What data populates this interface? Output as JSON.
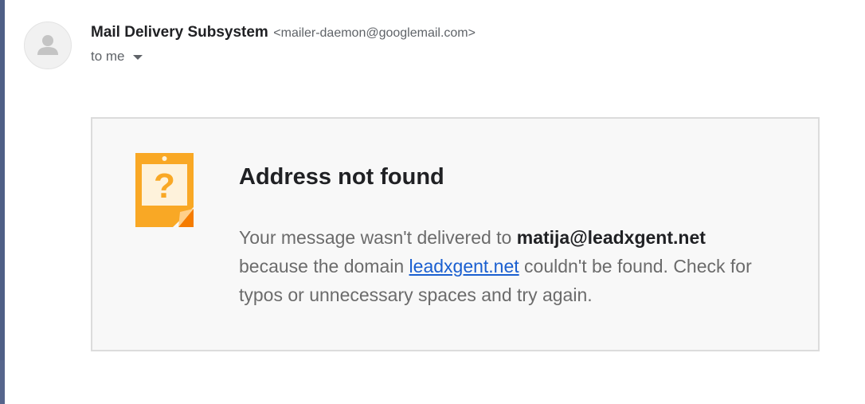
{
  "header": {
    "sender_name": "Mail Delivery Subsystem",
    "sender_email": "<mailer-daemon@googlemail.com>",
    "recipient": "to me"
  },
  "card": {
    "title": "Address not found",
    "line1_prefix": "Your message wasn't delivered to ",
    "recipient_address": "matija@leadxgent.net",
    "line2_prefix": "because the domain ",
    "domain_link": "leadxgent.net",
    "line2_suffix": " couldn't be found. Check for",
    "line3": "typos or unnecessary spaces and try again."
  },
  "icons": {
    "avatar": "person-icon",
    "dropdown": "chevron-down-icon",
    "notice": "question-note-icon"
  },
  "colors": {
    "note_orange": "#f9a825",
    "link_blue": "#1a5fd0",
    "card_background": "#f8f8f8"
  }
}
